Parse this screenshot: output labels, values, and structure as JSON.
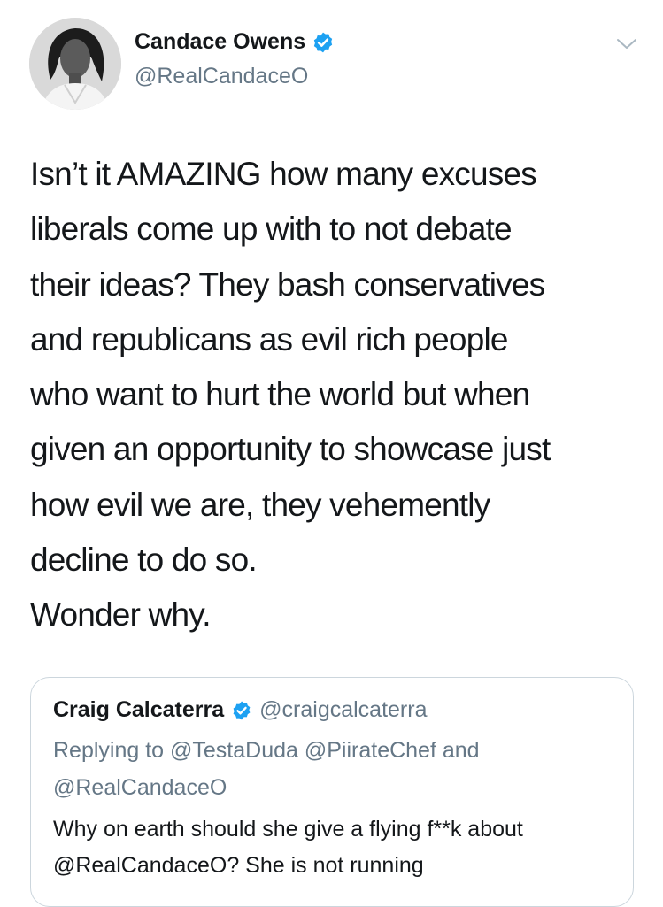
{
  "author": {
    "name": "Candace Owens",
    "handle": "@RealCandaceO",
    "verified_icon": "verified-badge-icon",
    "avatar": "avatar-photo"
  },
  "menu": {
    "icon": "chevron-down-icon"
  },
  "tweet": {
    "text": "Isn’t it AMAZING how many excuses\nliberals come up with to not debate\ntheir ideas? They bash conservatives\nand republicans as evil rich people\nwho want to hurt the world but when\ngiven an opportunity to showcase just\nhow evil we are, they vehemently\ndecline to do so.\nWonder why."
  },
  "quoted_tweet": {
    "name": "Craig Calcaterra",
    "handle": "@craigcalcaterra",
    "replying_to": "Replying to @TestaDuda @PiirateChef and @RealCandaceO",
    "text": "Why on earth should she give a flying f**k about @RealCandaceO? She is not running"
  },
  "colors": {
    "primary_text": "#14171a",
    "secondary_text": "#657786",
    "verified_blue": "#1da1f2",
    "border": "#ccd6dd"
  }
}
